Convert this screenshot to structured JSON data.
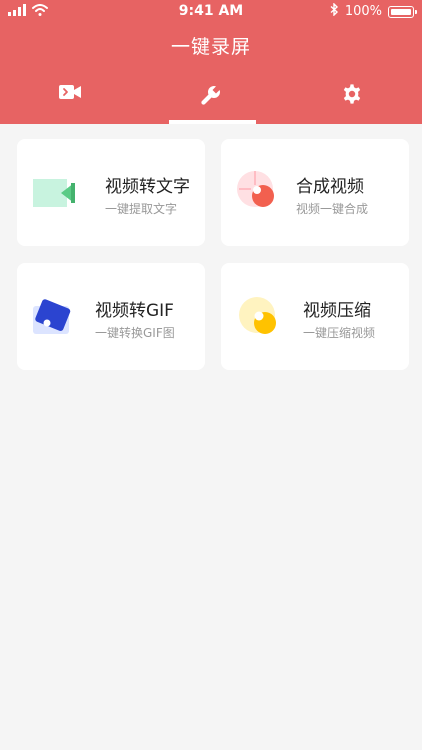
{
  "status_bar": {
    "time": "9:41 AM",
    "battery": "100%"
  },
  "app": {
    "title": "一键录屏"
  },
  "tabs": [
    {
      "icon": "video-icon",
      "active": false
    },
    {
      "icon": "wrench-icon",
      "active": true
    },
    {
      "icon": "gear-icon",
      "active": false
    }
  ],
  "colors": {
    "header": "#e76363",
    "background": "#f5f5f5",
    "card": "#ffffff"
  },
  "tools": [
    {
      "title": "视频转文字",
      "subtitle": "一键提取文字",
      "icon": "video-to-text-icon"
    },
    {
      "title": "合成视频",
      "subtitle": "视频一键合成",
      "icon": "merge-video-icon"
    },
    {
      "title": "视频转GIF",
      "subtitle": "一键转换GIF图",
      "icon": "video-to-gif-icon"
    },
    {
      "title": "视频压缩",
      "subtitle": "一键压缩视频",
      "icon": "compress-video-icon"
    }
  ]
}
